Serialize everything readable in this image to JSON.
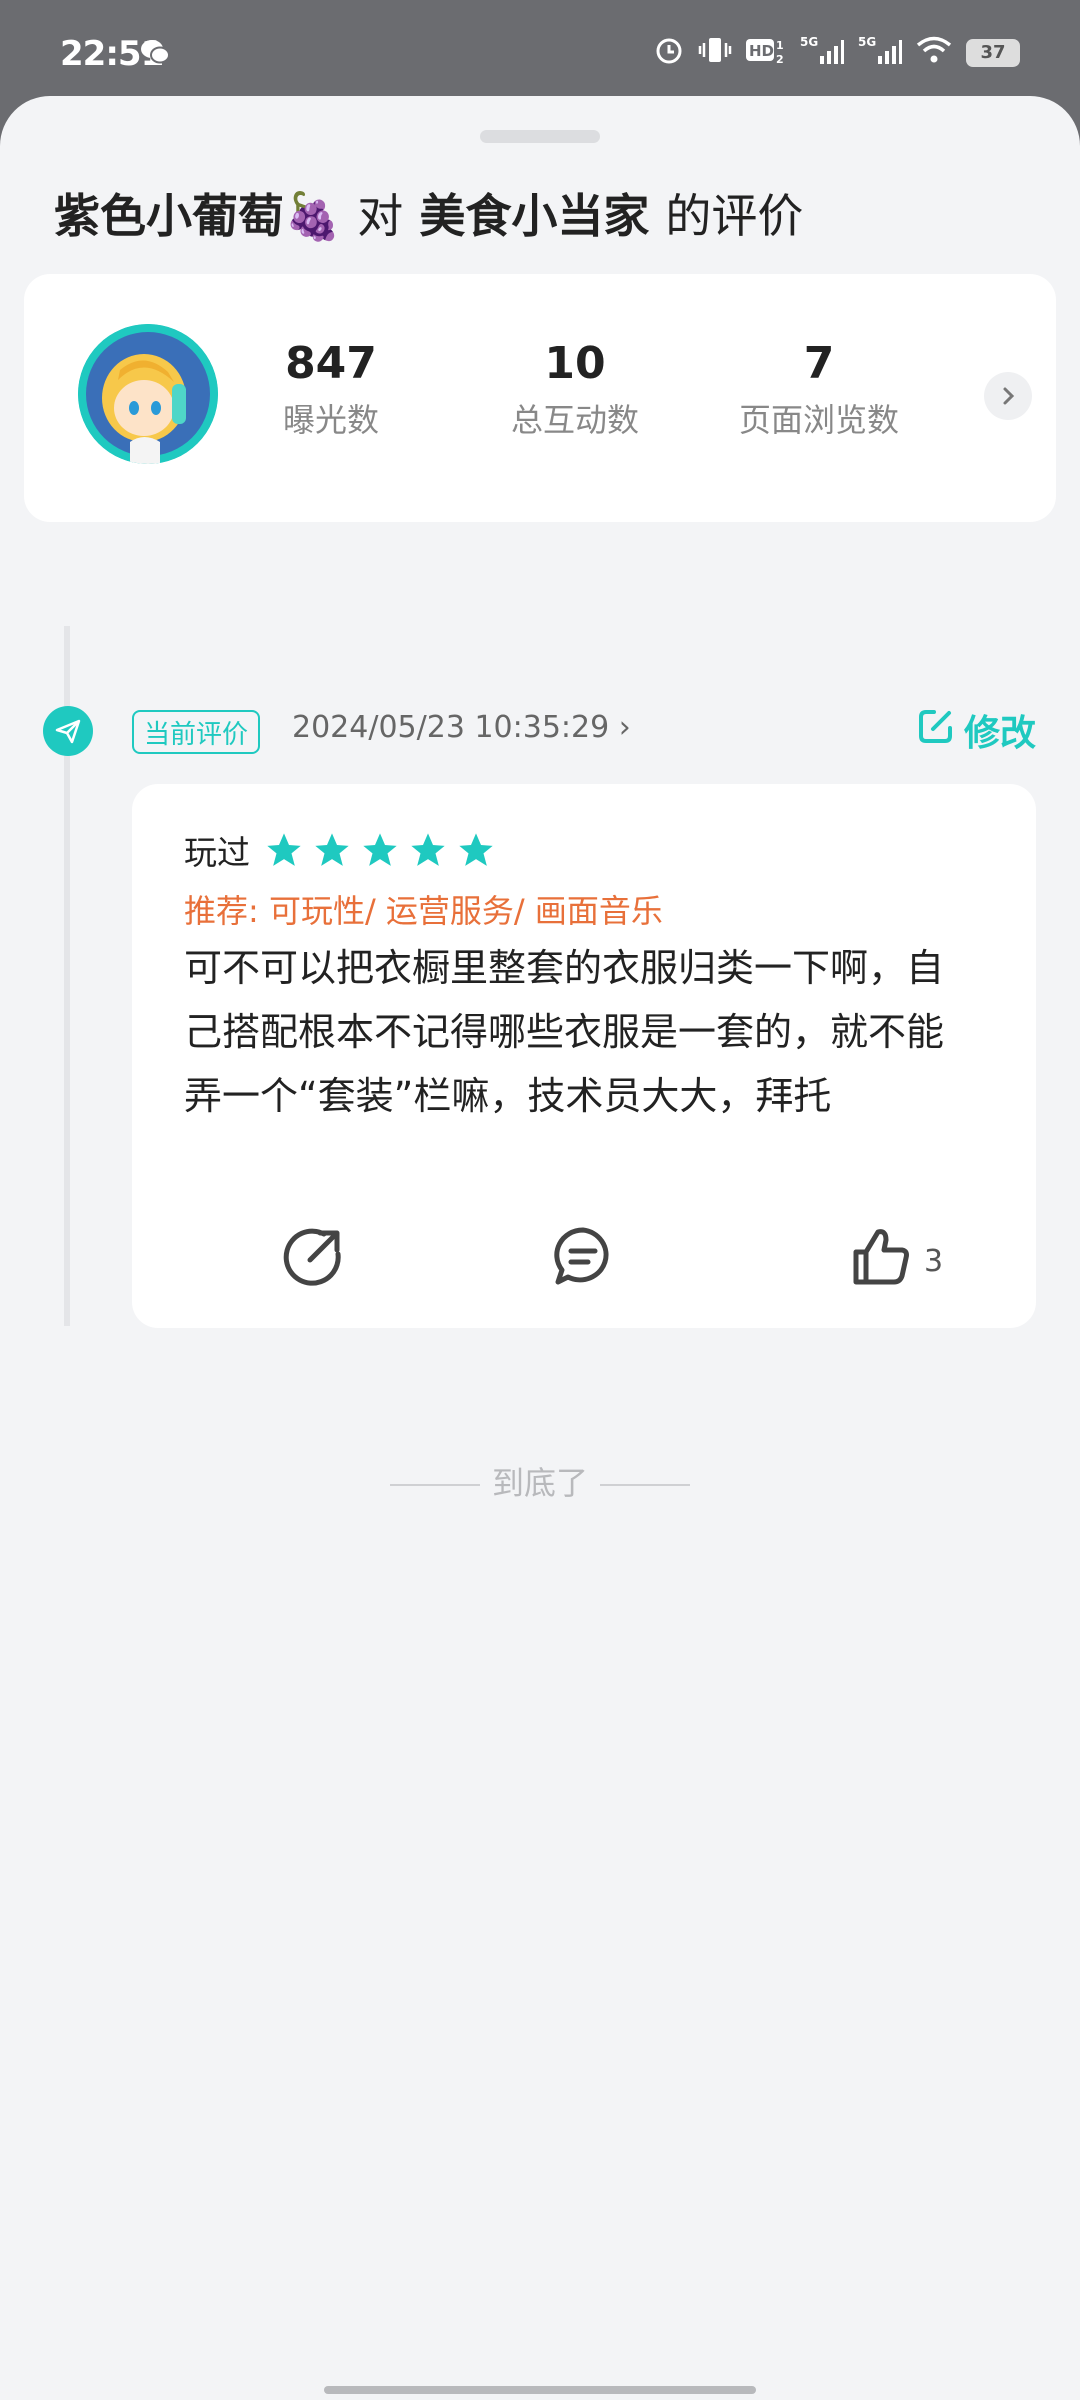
{
  "status_bar": {
    "time": "22:51",
    "battery": "37",
    "icons": [
      "wechat-icon",
      "alarm-icon",
      "vibrate-icon",
      "hd-icon",
      "signal-5g-icon",
      "signal-5g-icon",
      "wifi-icon",
      "battery-icon"
    ]
  },
  "header": {
    "user_name": "紫色小葡萄🍇",
    "connector": "对",
    "game_name": "美食小当家",
    "suffix": "的评价"
  },
  "stats": [
    {
      "value": "847",
      "label": "曝光数"
    },
    {
      "value": "10",
      "label": "总互动数"
    },
    {
      "value": "7",
      "label": "页面浏览数"
    }
  ],
  "review": {
    "badge": "当前评价",
    "date": "2024/05/23 10:35:29",
    "edit_label": "修改",
    "status": "玩过",
    "stars": 5,
    "recommend": "推荐: 可玩性/ 运营服务/ 画面音乐",
    "content": "可不可以把衣橱里整套的衣服归类一下啊，自己搭配根本不记得哪些衣服是一套的，就不能弄一个“套装”栏嘛，技术员大大，拜托",
    "like_count": "3"
  },
  "footer": {
    "end_text": "到底了"
  },
  "colors": {
    "accent": "#1fc9c0",
    "recommend": "#e8703a"
  }
}
